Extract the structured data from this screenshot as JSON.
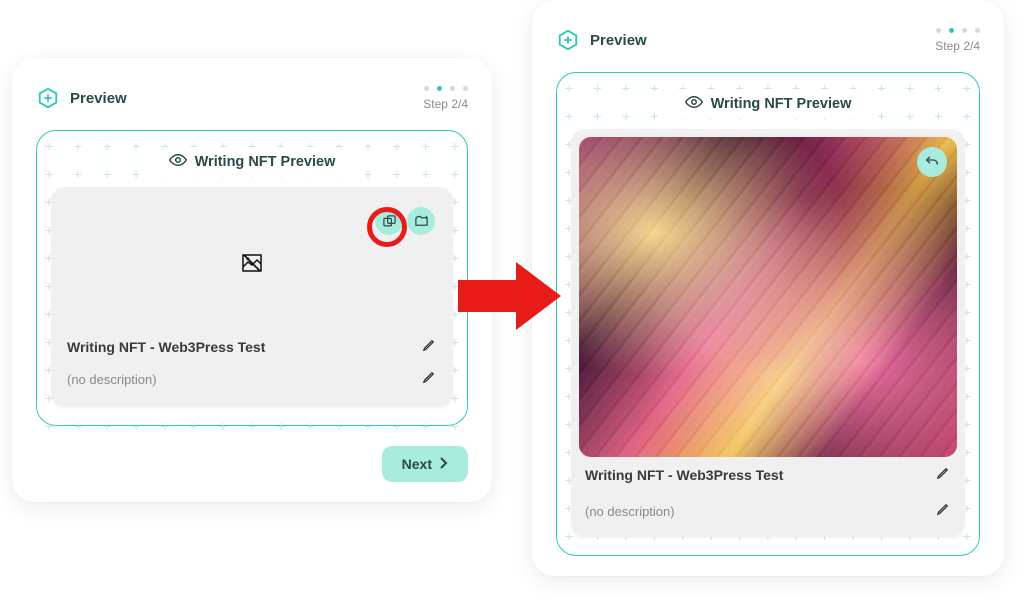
{
  "left": {
    "headerTitle": "Preview",
    "step": "Step 2/4",
    "activeDot": 1,
    "innerTitle": "Writing NFT Preview",
    "cardTitle": "Writing NFT - Web3Press Test",
    "cardDesc": "(no description)",
    "nextLabel": "Next"
  },
  "right": {
    "headerTitle": "Preview",
    "step": "Step 2/4",
    "activeDot": 1,
    "innerTitle": "Writing NFT Preview",
    "cardTitle": "Writing NFT - Web3Press Test",
    "cardDesc": "(no description)"
  }
}
